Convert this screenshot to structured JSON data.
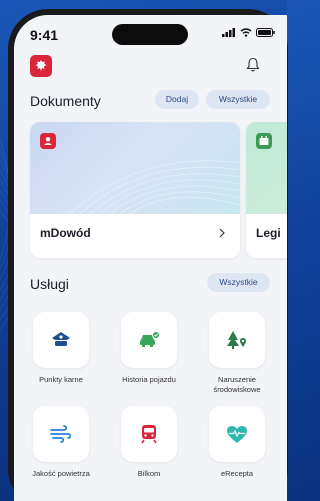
{
  "status": {
    "time": "9:41"
  },
  "colors": {
    "brand_red": "#d9263b",
    "accent_blue": "#2b4c85",
    "pill_bg": "#dfe6f3"
  },
  "documents": {
    "title": "Dokumenty",
    "add_label": "Dodaj",
    "all_label": "Wszystkie",
    "cards": [
      {
        "name": "mDowód",
        "icon": "id-card-icon"
      },
      {
        "name": "Legi",
        "icon": "student-id-icon"
      }
    ]
  },
  "services": {
    "title": "Usługi",
    "all_label": "Wszystkie",
    "items": [
      {
        "label": "Punkty karne",
        "icon": "police-cap-icon"
      },
      {
        "label": "Historia pojazdu",
        "icon": "car-check-icon"
      },
      {
        "label": "Naruszenie środowiskowe",
        "icon": "tree-location-icon"
      },
      {
        "label": "Jakość powietrza",
        "icon": "wind-icon"
      },
      {
        "label": "Bilkom",
        "icon": "train-icon"
      },
      {
        "label": "eRecepta",
        "icon": "heart-pulse-icon"
      }
    ]
  }
}
